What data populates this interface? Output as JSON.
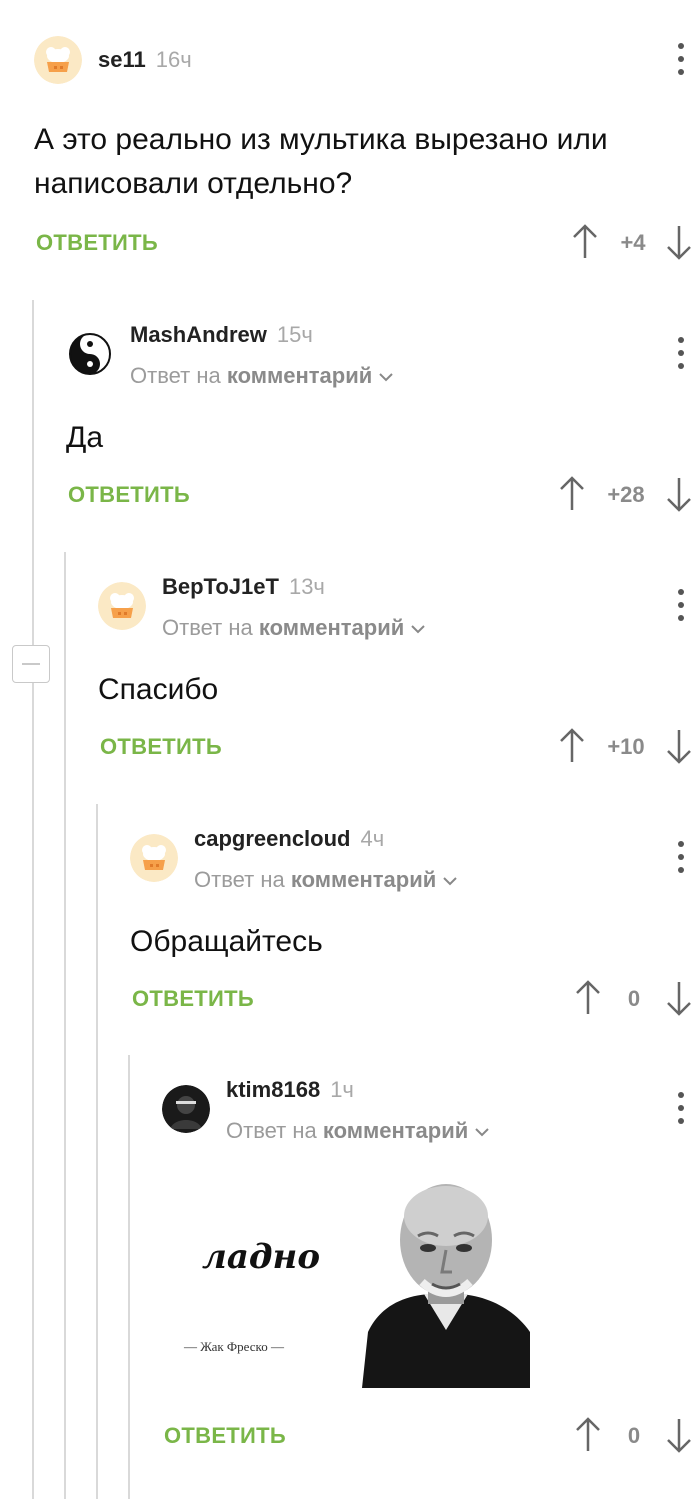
{
  "labels": {
    "reply": "ОТВЕТИТЬ",
    "reply_to_prefix": "Ответ на",
    "reply_to_target": "комментарий"
  },
  "comments": [
    {
      "username": "se11",
      "time": "16ч",
      "text_lines": [
        "А это реально из мультика вырезано или",
        "написовали отдельно?"
      ],
      "score": "+4",
      "avatar_icon": "chef-hat-avatar-icon"
    },
    {
      "username": "MashAndrew",
      "time": "15ч",
      "text": "Да",
      "score": "+28",
      "avatar_icon": "yin-yang-avatar-icon"
    },
    {
      "username": "BepToJ1eT",
      "time": "13ч",
      "text": "Спасибо",
      "score": "+10",
      "avatar_icon": "chef-hat-avatar-icon"
    },
    {
      "username": "capgreencloud",
      "time": "4ч",
      "text": "Обращайтесь",
      "score": "0",
      "avatar_icon": "chef-hat-avatar-icon"
    },
    {
      "username": "ktim8168",
      "time": "1ч",
      "score": "0",
      "avatar_icon": "dark-profile-avatar-icon",
      "meme": {
        "word": "ладно",
        "signature": "— Жак Фреско —"
      }
    }
  ],
  "colors": {
    "accent": "#7ab648",
    "muted": "#9b9b9b"
  }
}
